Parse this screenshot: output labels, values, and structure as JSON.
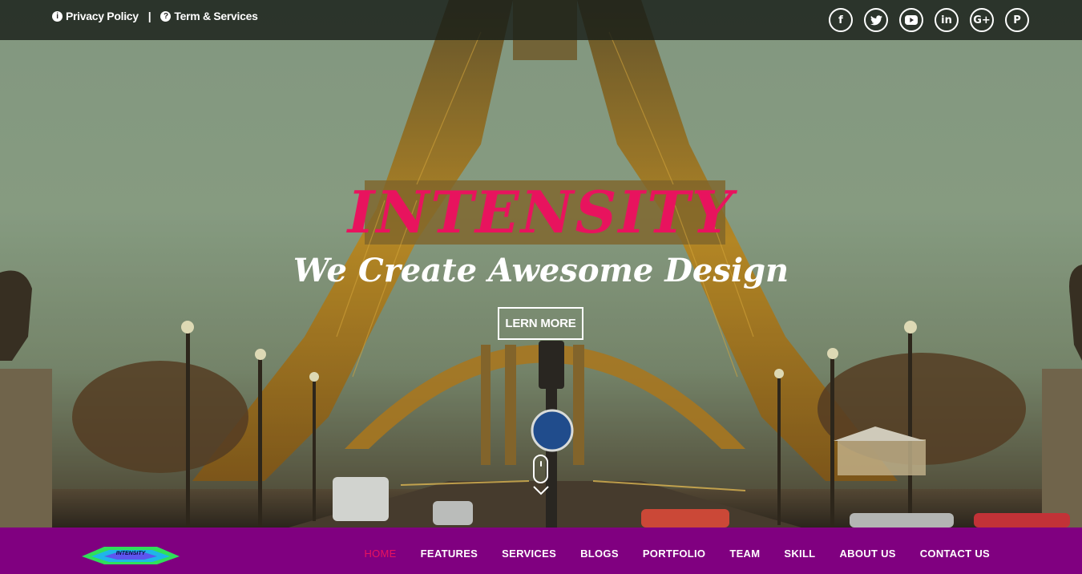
{
  "topbar": {
    "links": [
      {
        "icon": "info-icon",
        "label": "Privacy Policy"
      },
      {
        "icon": "question-icon",
        "label": "Term & Services"
      }
    ],
    "separator": "|",
    "social": [
      {
        "icon": "facebook-icon",
        "glyph": "f"
      },
      {
        "icon": "twitter-icon",
        "glyph": "t"
      },
      {
        "icon": "youtube-icon",
        "glyph": "▶"
      },
      {
        "icon": "linkedin-icon",
        "glyph": "in"
      },
      {
        "icon": "google-plus-icon",
        "glyph": "G+"
      },
      {
        "icon": "pinterest-icon",
        "glyph": "P"
      }
    ]
  },
  "hero": {
    "brand": "INTENSITY",
    "tagline": "We Create Awesome Design",
    "cta_label": "LERN MORE"
  },
  "navbar": {
    "logo_text": "INTENSITY",
    "items": [
      "HOME",
      "FEATURES",
      "SERVICES",
      "BLOGS",
      "PORTFOLIO",
      "TEAM",
      "SKILL",
      "ABOUT US",
      "CONTACT US"
    ],
    "active_item": "HOME"
  },
  "colors": {
    "accent": "#e8135e",
    "nav_bg": "#800080",
    "topbar_bg": "#1e231e"
  }
}
